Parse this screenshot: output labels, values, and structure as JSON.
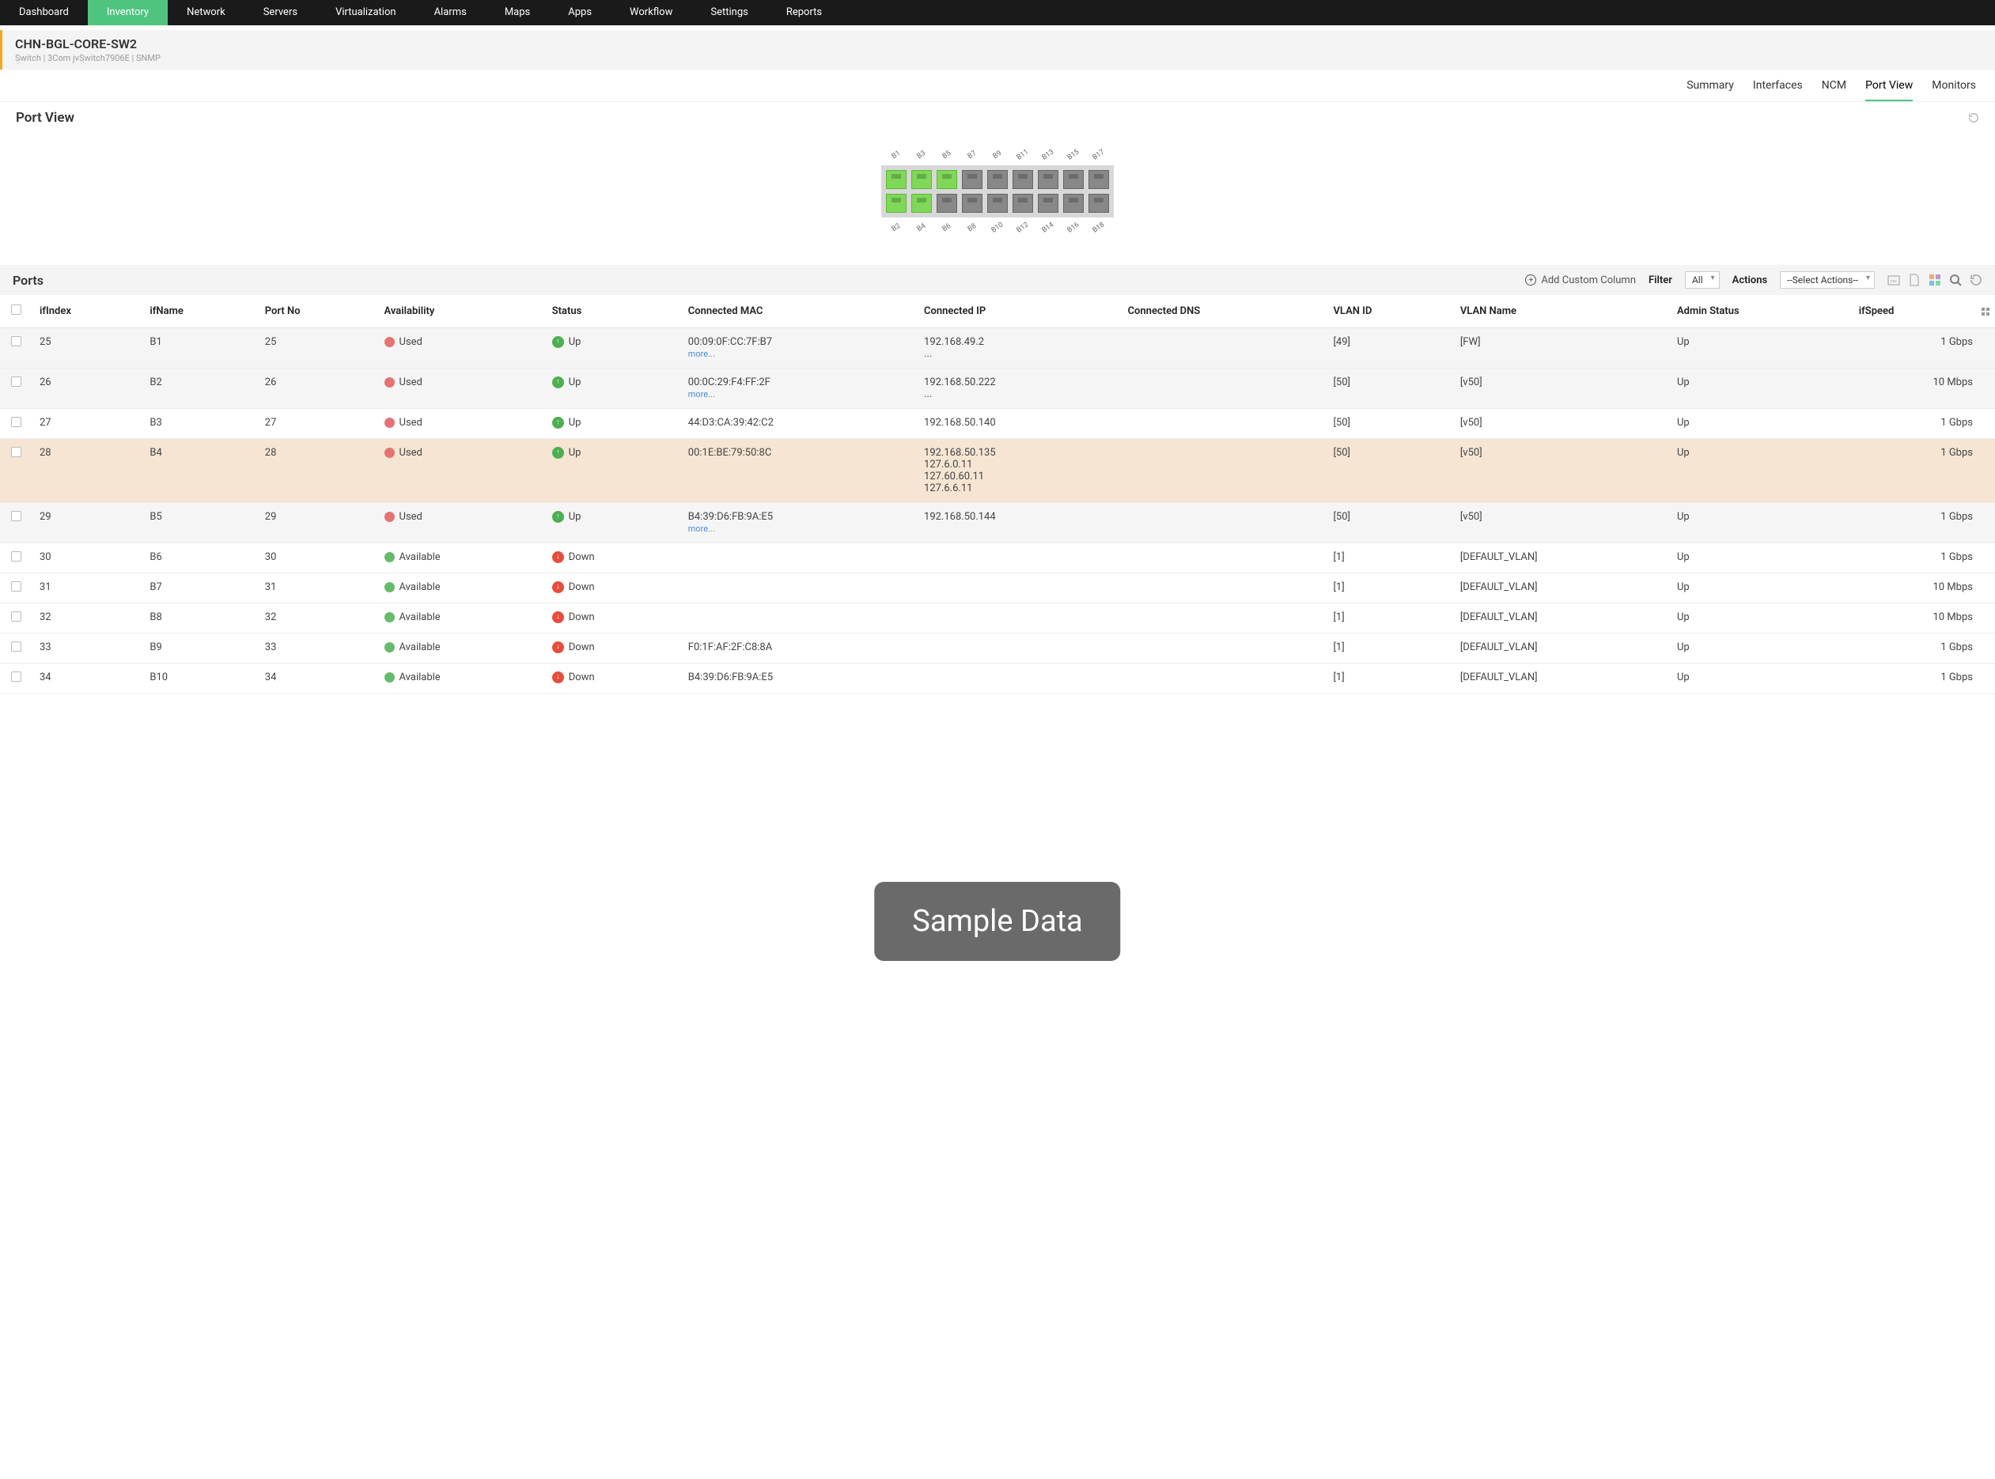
{
  "nav": {
    "items": [
      "Dashboard",
      "Inventory",
      "Network",
      "Servers",
      "Virtualization",
      "Alarms",
      "Maps",
      "Apps",
      "Workflow",
      "Settings",
      "Reports"
    ],
    "active": 1
  },
  "device": {
    "name": "CHN-BGL-CORE-SW2",
    "subtitle": "Switch | 3Com jvSwitch7906E | SNMP"
  },
  "subtabs": {
    "items": [
      "Summary",
      "Interfaces",
      "NCM",
      "Port View",
      "Monitors"
    ],
    "active": 3
  },
  "portview": {
    "title": "Port View",
    "top_labels": [
      "B1",
      "B3",
      "B5",
      "B7",
      "B9",
      "B11",
      "B13",
      "B15",
      "B17"
    ],
    "bottom_labels": [
      "B2",
      "B4",
      "B6",
      "B8",
      "B10",
      "B12",
      "B14",
      "B16",
      "B18"
    ],
    "row1_status": [
      "up",
      "up",
      "up",
      "down",
      "down",
      "down",
      "down",
      "down",
      "down"
    ],
    "row2_status": [
      "up",
      "up",
      "down",
      "down",
      "down",
      "down",
      "down",
      "down",
      "down"
    ]
  },
  "ports_section": {
    "title": "Ports",
    "add_col": "Add Custom Column",
    "filter_label": "Filter",
    "filter_value": "All",
    "actions_label": "Actions",
    "actions_value": "--Select Actions--"
  },
  "table": {
    "headers": [
      "ifIndex",
      "ifName",
      "Port No",
      "Availability",
      "Status",
      "Connected MAC",
      "Connected IP",
      "Connected DNS",
      "VLAN ID",
      "VLAN Name",
      "Admin Status",
      "ifSpeed"
    ],
    "rows": [
      {
        "ifIndex": "25",
        "ifName": "B1",
        "portNo": "25",
        "availability": "Used",
        "status": "Up",
        "mac": "00:09:0F:CC:7F:B7",
        "macMore": true,
        "ip": "192.168.49.2",
        "ipMore": true,
        "dns": "",
        "vlanId": "[49]",
        "vlanName": "[FW]",
        "admin": "Up",
        "speed": "1 Gbps",
        "shade": true
      },
      {
        "ifIndex": "26",
        "ifName": "B2",
        "portNo": "26",
        "availability": "Used",
        "status": "Up",
        "mac": "00:0C:29:F4:FF:2F",
        "macMore": true,
        "ip": "192.168.50.222",
        "ipMore": true,
        "dns": "",
        "vlanId": "[50]",
        "vlanName": "[v50]",
        "admin": "Up",
        "speed": "10 Mbps",
        "shade": true
      },
      {
        "ifIndex": "27",
        "ifName": "B3",
        "portNo": "27",
        "availability": "Used",
        "status": "Up",
        "mac": "44:D3:CA:39:42:C2",
        "macMore": false,
        "ip": "192.168.50.140",
        "ipMore": false,
        "dns": "",
        "vlanId": "[50]",
        "vlanName": "[v50]",
        "admin": "Up",
        "speed": "1 Gbps",
        "shade": false
      },
      {
        "ifIndex": "28",
        "ifName": "B4",
        "portNo": "28",
        "availability": "Used",
        "status": "Up",
        "mac": "00:1E:BE:79:50:8C",
        "macMore": false,
        "ip": "192.168.50.135\n127.6.0.11\n127.60.60.11\n127.6.6.11",
        "ipMore": false,
        "dns": "",
        "vlanId": "[50]",
        "vlanName": "[v50]",
        "admin": "Up",
        "speed": "1 Gbps",
        "highlight": true
      },
      {
        "ifIndex": "29",
        "ifName": "B5",
        "portNo": "29",
        "availability": "Used",
        "status": "Up",
        "mac": "B4:39:D6:FB:9A:E5",
        "macMore": true,
        "ip": "192.168.50.144",
        "ipMore": false,
        "dns": "",
        "vlanId": "[50]",
        "vlanName": "[v50]",
        "admin": "Up",
        "speed": "1 Gbps",
        "shade": true
      },
      {
        "ifIndex": "30",
        "ifName": "B6",
        "portNo": "30",
        "availability": "Available",
        "status": "Down",
        "mac": "",
        "macMore": false,
        "ip": "",
        "ipMore": false,
        "dns": "",
        "vlanId": "[1]",
        "vlanName": "[DEFAULT_VLAN]",
        "admin": "Up",
        "speed": "1 Gbps",
        "shade": false
      },
      {
        "ifIndex": "31",
        "ifName": "B7",
        "portNo": "31",
        "availability": "Available",
        "status": "Down",
        "mac": "",
        "macMore": false,
        "ip": "",
        "ipMore": false,
        "dns": "",
        "vlanId": "[1]",
        "vlanName": "[DEFAULT_VLAN]",
        "admin": "Up",
        "speed": "10 Mbps",
        "shade": false
      },
      {
        "ifIndex": "32",
        "ifName": "B8",
        "portNo": "32",
        "availability": "Available",
        "status": "Down",
        "mac": "",
        "macMore": false,
        "ip": "",
        "ipMore": false,
        "dns": "",
        "vlanId": "[1]",
        "vlanName": "[DEFAULT_VLAN]",
        "admin": "Up",
        "speed": "10 Mbps",
        "shade": false
      },
      {
        "ifIndex": "33",
        "ifName": "B9",
        "portNo": "33",
        "availability": "Available",
        "status": "Down",
        "mac": "F0:1F:AF:2F:C8:8A",
        "macMore": false,
        "ip": "",
        "ipMore": false,
        "dns": "",
        "vlanId": "[1]",
        "vlanName": "[DEFAULT_VLAN]",
        "admin": "Up",
        "speed": "1 Gbps",
        "shade": false
      },
      {
        "ifIndex": "34",
        "ifName": "B10",
        "portNo": "34",
        "availability": "Available",
        "status": "Down",
        "mac": "B4:39:D6:FB:9A:E5",
        "macMore": false,
        "ip": "",
        "ipMore": false,
        "dns": "",
        "vlanId": "[1]",
        "vlanName": "[DEFAULT_VLAN]",
        "admin": "Up",
        "speed": "1 Gbps",
        "shade": false
      }
    ],
    "more_label": "more..."
  },
  "watermark": "Sample Data"
}
